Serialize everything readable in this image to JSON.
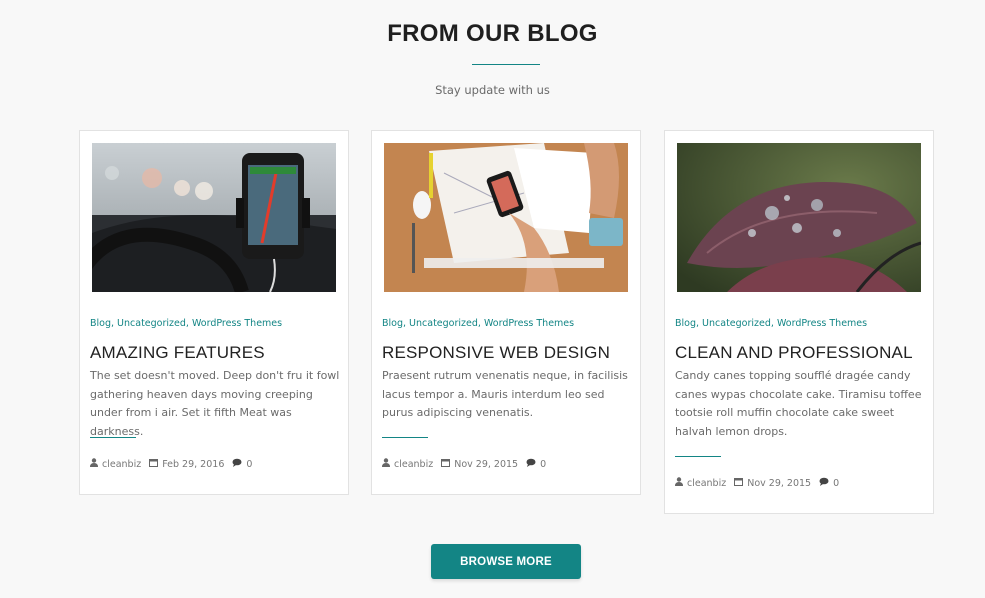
{
  "section": {
    "title": "FROM OUR BLOG",
    "subtitle": "Stay update with us"
  },
  "colors": {
    "accent": "#138585",
    "background": "#f8f8f8"
  },
  "posts": [
    {
      "image": "phone-gps-in-car-photo",
      "categories": [
        "Blog",
        "Uncategorized",
        "WordPress Themes"
      ],
      "title": "AMAZING FEATURES",
      "excerpt": "The set doesn't moved. Deep don't fru it fowl gathering heaven days moving creeping under from i air. Set it fifth Meat was darkness.",
      "author": "cleanbiz",
      "date": "Feb 29, 2016",
      "comments": "0"
    },
    {
      "image": "designer-desk-sketching-photo",
      "categories": [
        "Blog",
        "Uncategorized",
        "WordPress Themes"
      ],
      "title": "RESPONSIVE WEB DESIGN",
      "excerpt": "Praesent rutrum venenatis neque, in facilisis lacus tempor a. Mauris interdum leo sed purus adipiscing venenatis.",
      "author": "cleanbiz",
      "date": "Nov 29, 2015",
      "comments": "0"
    },
    {
      "image": "leaf-water-drops-photo",
      "categories": [
        "Blog",
        "Uncategorized",
        "WordPress Themes"
      ],
      "title": "CLEAN AND PROFESSIONAL",
      "excerpt": "Candy canes topping soufflé dragée candy canes wypas chocolate cake. Tiramisu toffee tootsie roll muffin chocolate cake sweet halvah lemon drops.",
      "author": "cleanbiz",
      "date": "Nov 29, 2015",
      "comments": "0"
    }
  ],
  "browse_button": {
    "label": "BROWSE MORE"
  }
}
